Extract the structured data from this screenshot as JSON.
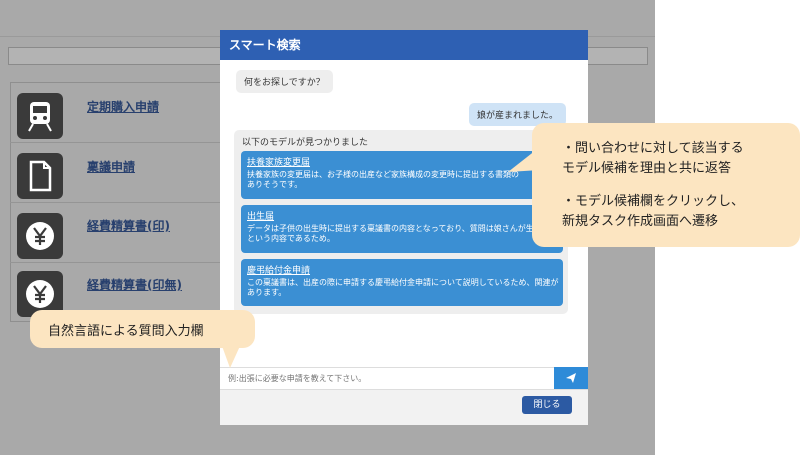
{
  "background": {
    "items": [
      {
        "label": "定期購入申請",
        "icon": "train-icon"
      },
      {
        "label": "稟議申請",
        "icon": "document-icon"
      },
      {
        "label": "経費精算書(印)",
        "icon": "yen-icon"
      },
      {
        "label": "経費精算書(印無)",
        "icon": "yen-icon"
      }
    ]
  },
  "modal": {
    "title": "スマート検索",
    "bot_prompt": "何をお探しですか？",
    "user_message": "娘が産まれました。",
    "results_title": "以下のモデルが見つかりました",
    "results": [
      {
        "title": "扶養家族変更届",
        "description": [
          "扶養家族の変更届は、お子様の出産など家族構成の変更時に提出する書類の",
          "ありそうです。"
        ]
      },
      {
        "title": "出生届",
        "description": [
          "データは子供の出生時に提出する稟議書の内容となっており、質問は娘さんが生",
          "という内容であるため。"
        ]
      },
      {
        "title": "慶弔給付金申請",
        "description": [
          "この稟議書は、出産の際に申請する慶弔給付金申請について説明しているため、関連が",
          "あります。"
        ]
      }
    ],
    "input_placeholder": "例:出張に必要な申請を教えて下さい。",
    "close_label": "閉じる"
  },
  "annotations": {
    "right": [
      "・問い合わせに対して該当する",
      "モデル候補を理由と共に返答",
      "・モデル候補欄をクリックし、",
      "新規タスク作成画面へ遷移"
    ],
    "left": "自然言語による質問入力欄"
  },
  "colors": {
    "header": "#2e60b3",
    "card": "#3b8fd3",
    "callout": "#fce5c1",
    "overlay": "#a9a9a9"
  }
}
